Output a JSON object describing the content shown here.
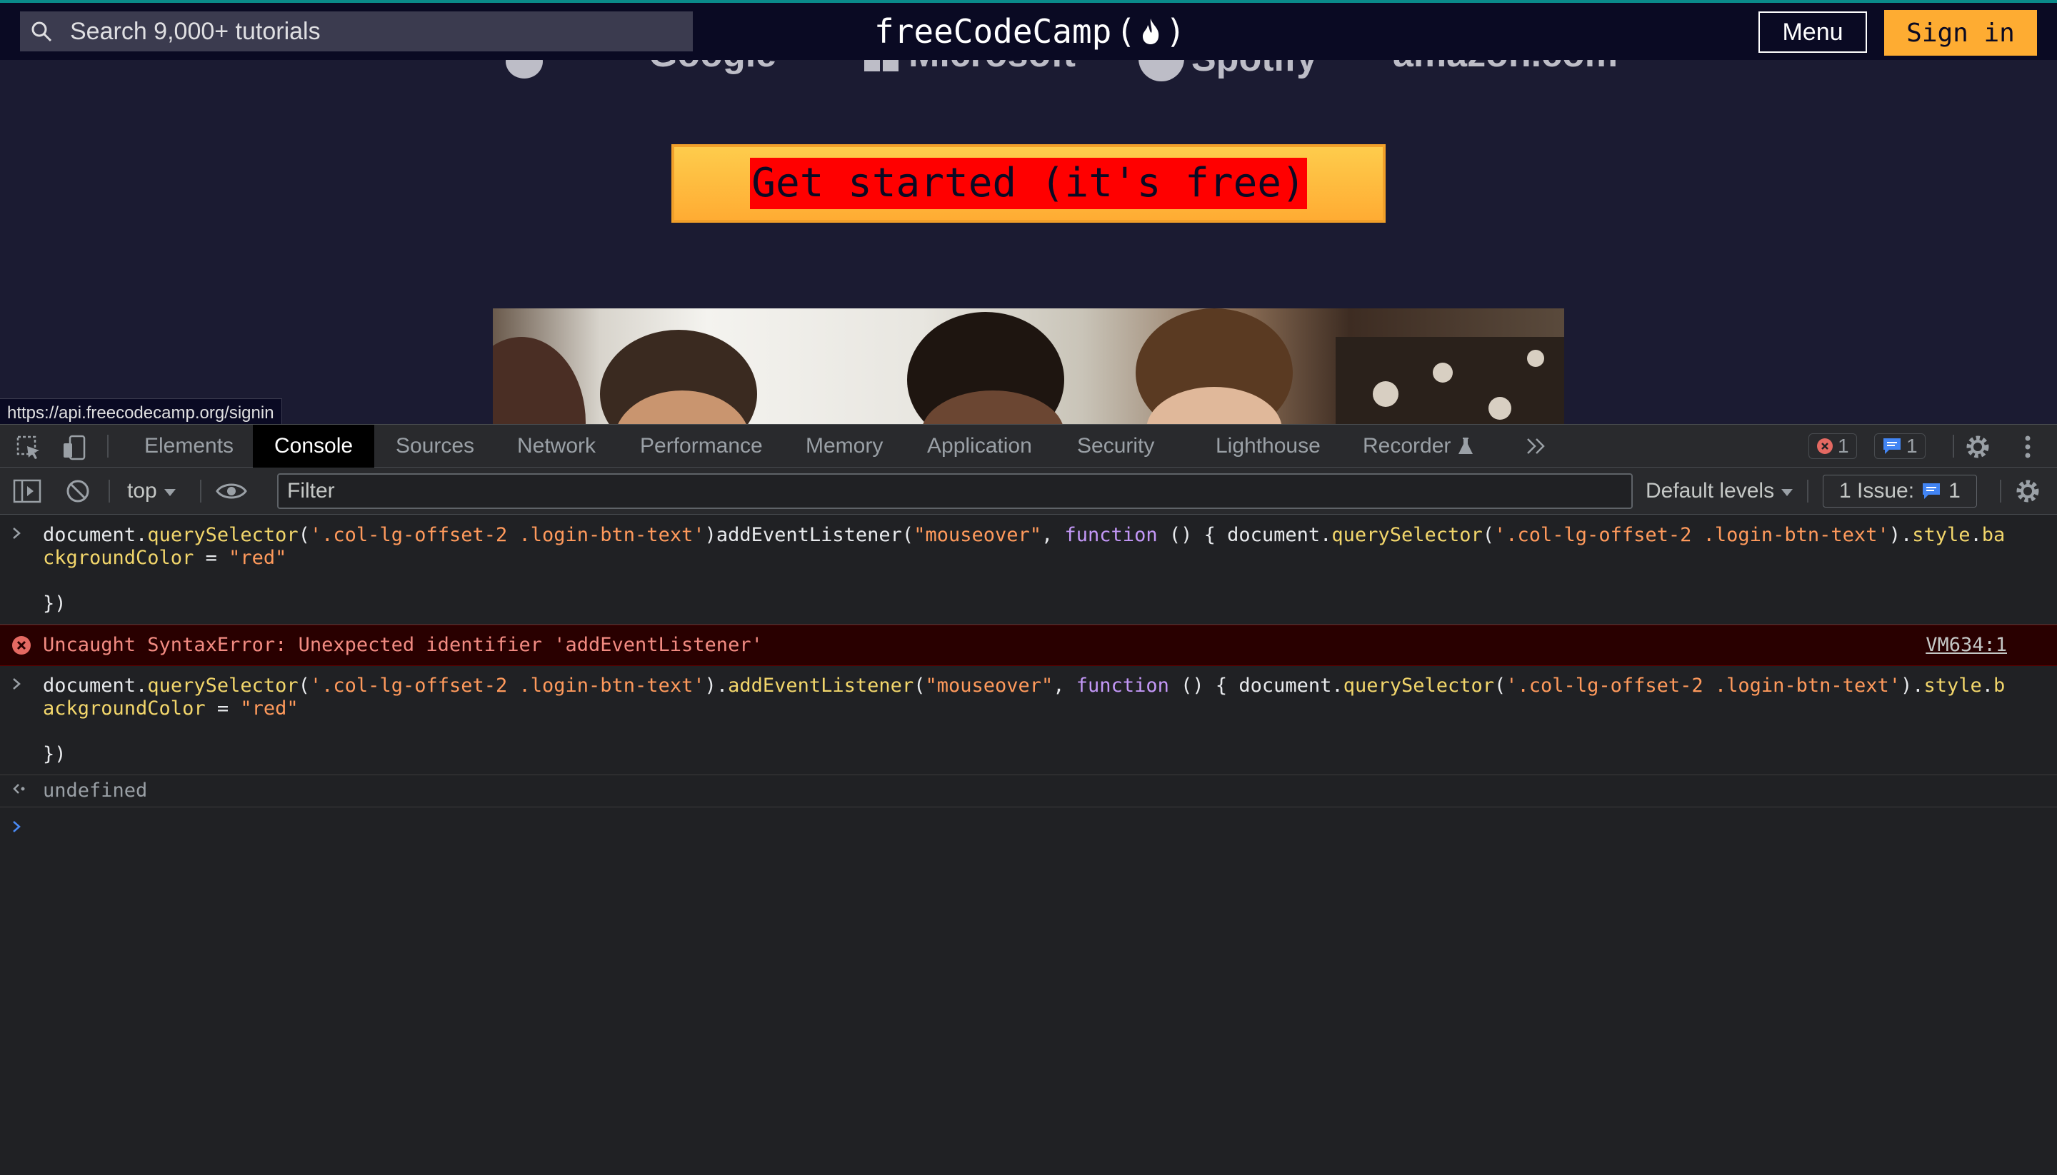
{
  "page": {
    "search_placeholder": "Search 9,000+ tutorials",
    "brand": "freeCodeCamp",
    "brand_paren_open": "(",
    "brand_paren_close": ")",
    "menu_label": "Menu",
    "signin_label": "Sign in",
    "logos": [
      "Apple",
      "Google",
      "Microsoft",
      "Spotify",
      "amazon.com"
    ],
    "cta_label": "Get started (it's free)",
    "status_url": "https://api.freecodecamp.org/signin"
  },
  "devtools": {
    "tabs": [
      "Elements",
      "Console",
      "Sources",
      "Network",
      "Performance",
      "Memory",
      "Application",
      "Security",
      "Lighthouse",
      "Recorder"
    ],
    "active_tab": "Console",
    "error_count": "1",
    "message_count": "1",
    "context": "top",
    "filter_placeholder": "Filter",
    "levels_label": "Default levels",
    "issues_label": "1 Issue:",
    "issues_count": "1"
  },
  "console": {
    "entry1": {
      "l1_a": "document.",
      "l1_b": "querySelector",
      "l1_c": "(",
      "l1_d": "'.col-lg-offset-2 .login-btn-text'",
      "l1_e": ")addEventListener(",
      "l1_f": "\"mouseover\"",
      "l1_g": ", ",
      "l1_h": "function",
      "l1_i": " () { document.",
      "l1_j": "querySelector",
      "l1_k": "(",
      "l1_l": "'.col-lg-offset-2 .login-btn-text'",
      "l1_m": ").",
      "l1_n": "style",
      "l1_o": ".",
      "l1_p": "backgroundColor",
      "l1_q": " = ",
      "l1_r": "\"red\"",
      "l3": "})"
    },
    "error": {
      "text": "Uncaught SyntaxError: Unexpected identifier 'addEventListener'",
      "link": "VM634:1"
    },
    "entry2": {
      "l1_a": "document.",
      "l1_b": "querySelector",
      "l1_c": "(",
      "l1_d": "'.col-lg-offset-2 .login-btn-text'",
      "l1_e": ").",
      "l1_e2": "addEventListener",
      "l1_e3": "(",
      "l1_f": "\"mouseover\"",
      "l1_g": ", ",
      "l1_h": "function",
      "l1_i": " () { document.",
      "l1_j": "querySelector",
      "l1_k": "(",
      "l1_l": "'.col-lg-offset-2 .login-btn-text'",
      "l1_m": ").",
      "l1_n": "style",
      "l1_o": ".",
      "l1_p": "backgroundColor",
      "l1_q": " = ",
      "l1_r": "\"red\"",
      "l3": "})"
    },
    "result": "undefined"
  },
  "colors": {
    "page_bg": "#1b1b32",
    "nav_bg": "#0a0a23",
    "cta_yellow": "#feac32",
    "cta_text_bg": "#ff0000",
    "devtools_bg": "#202124",
    "error_bg": "#290000",
    "error_text": "#f28b82"
  }
}
